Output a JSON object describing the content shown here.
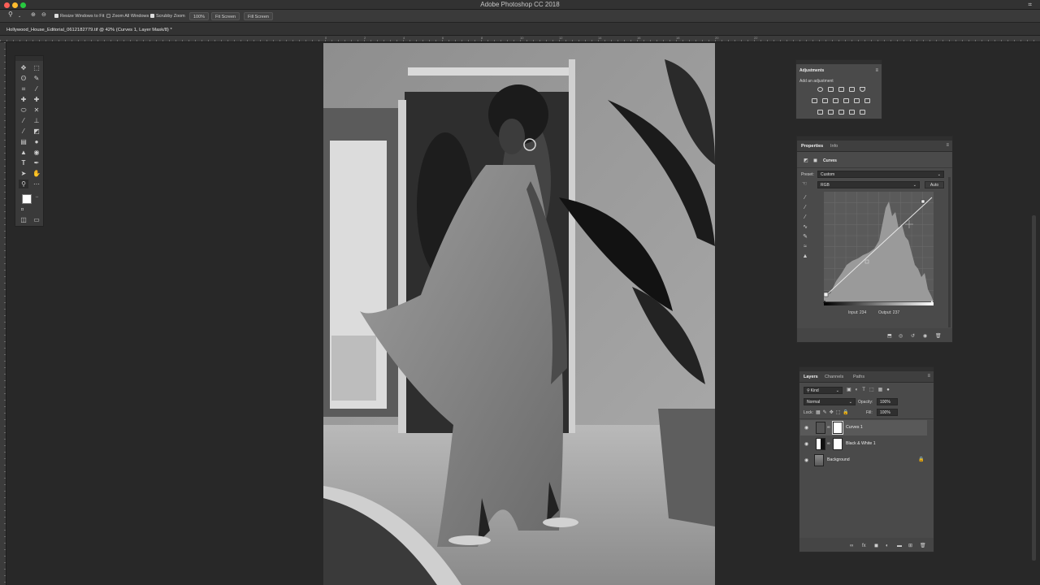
{
  "app": {
    "title": "Adobe Photoshop CC 2018"
  },
  "options_bar": {
    "resize_windows": "Resize Windows to Fit",
    "zoom_all_windows": "Zoom All Windows",
    "scrubby_zoom": "Scrubby Zoom",
    "zoom_value": "100%",
    "fit_screen_1": "Fit Screen",
    "fill_screen": "Fill Screen"
  },
  "document_tab": {
    "title": "Hollywood_House_Editorial_0612182779.tif @ 42% (Curves 1, Layer Mask/8) *"
  },
  "ruler": {
    "top_marks": [
      "0",
      "2",
      "4",
      "6",
      "8",
      "10",
      "12",
      "14",
      "16",
      "18",
      "20",
      "22"
    ]
  },
  "adjustments_panel": {
    "title": "Adjustments",
    "subtitle": "Add an adjustment"
  },
  "properties_panel": {
    "tabs": [
      "Properties",
      "Info"
    ],
    "adjustment_name": "Curves",
    "preset_label": "Preset:",
    "preset_value": "Custom",
    "channel_value": "RGB",
    "auto_button": "Auto",
    "input_label": "Input:",
    "input_value": "234",
    "output_label": "Output:",
    "output_value": "237"
  },
  "layers_panel": {
    "tabs": [
      "Layers",
      "Channels",
      "Paths"
    ],
    "kind_filter": "Kind",
    "blend_mode": "Normal",
    "opacity_label": "Opacity:",
    "opacity_value": "100%",
    "lock_label": "Lock:",
    "fill_label": "Fill:",
    "fill_value": "100%",
    "layers": [
      {
        "name": "Curves 1",
        "selected": true
      },
      {
        "name": "Black & White 1",
        "selected": false
      },
      {
        "name": "Background",
        "selected": false
      }
    ]
  },
  "colors": {
    "accent": "#2f6fde",
    "panel_bg": "#4a4a4a",
    "app_bg": "#282828"
  }
}
